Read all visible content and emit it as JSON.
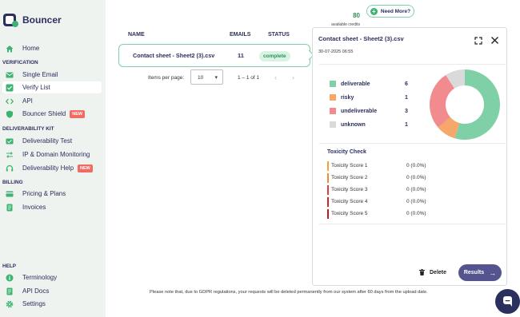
{
  "app": {
    "name": "Bouncer"
  },
  "colors": {
    "brand_dark": "#2b2f5e",
    "accent_green": "#3cb371",
    "sidebar_bg": "#eef3f0",
    "danger": "#f26b63"
  },
  "sidebar": {
    "home": "Home",
    "sections": {
      "verification": "VERIFICATION",
      "deliverability_kit": "DELIVERABILITY KIT",
      "billing": "BILLING",
      "help": "HELP"
    },
    "items": {
      "single_email": "Single Email",
      "verify_list": "Verify List",
      "api": "API",
      "bouncer_shield": "Bouncer Shield",
      "deliverability_test": "Deliverability Test",
      "ip_domain_monitoring": "IP & Domain Monitoring",
      "deliverability_help": "Deliverability Help",
      "pricing_plans": "Pricing & Plans",
      "invoices": "Invoices",
      "terminology": "Terminology",
      "api_docs": "API Docs",
      "settings": "Settings"
    },
    "badge_new": "NEW"
  },
  "topbar": {
    "credits_value": "80",
    "credits_label": "available credits",
    "need_more": "Need More?"
  },
  "table": {
    "headers": {
      "name": "NAME",
      "emails": "EMAILS",
      "status": "STATUS"
    },
    "rows": [
      {
        "name": "Contact sheet - Sheet2 (3).csv",
        "emails": "11",
        "status": "complete"
      }
    ],
    "pager": {
      "items_per_page_label": "Items per page:",
      "items_per_page_value": "10",
      "range": "1 – 1 of 1",
      "prev": "‹",
      "next": "›"
    }
  },
  "detail": {
    "title": "Contact sheet - Sheet2 (3).csv",
    "date": "30-07-2025 06:55",
    "legend": [
      {
        "label": "deliverable",
        "value": "6",
        "color": "#7fd0a6"
      },
      {
        "label": "risky",
        "value": "1",
        "color": "#f6a86a"
      },
      {
        "label": "undeliverable",
        "value": "3",
        "color": "#f28b8d"
      },
      {
        "label": "unknown",
        "value": "1",
        "color": "#d9dadb"
      }
    ],
    "toxicity": {
      "title": "Toxicity Check",
      "rows": [
        {
          "label": "Toxicity Score 1",
          "value": "0 (0.0%)",
          "color": "#f6a040"
        },
        {
          "label": "Toxicity Score 2",
          "value": "0 (0.0%)",
          "color": "#f08a30"
        },
        {
          "label": "Toxicity Score 3",
          "value": "0 (0.0%)",
          "color": "#e23b3b"
        },
        {
          "label": "Toxicity Score 4",
          "value": "0 (0.0%)",
          "color": "#d92020"
        },
        {
          "label": "Toxicity Score 5",
          "value": "0 (0.0%)",
          "color": "#c81515"
        }
      ]
    },
    "delete_label": "Delete",
    "results_label": "Results"
  },
  "footer": {
    "gdpr_note": "Please note that, due to GDPR regulations, your requests will be deleted permanently from our system after 60 days from the upload date."
  }
}
